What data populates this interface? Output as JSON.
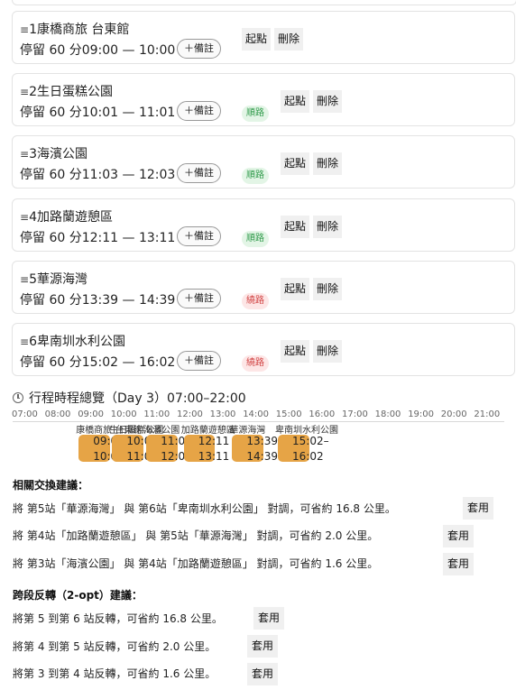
{
  "stops": [
    {
      "index": "1",
      "name": "康橋商旅 台東館",
      "stay": "停留 60 分",
      "time": "09:00 — 10:00",
      "memo": "＋備註",
      "route_badge": "",
      "start_label": "起點",
      "delete_label": "刪除"
    },
    {
      "index": "2",
      "name": "生日蛋糕公園",
      "stay": "停留 60 分",
      "time": "10:01 — 11:01",
      "memo": "＋備註",
      "route_badge": "順路",
      "route_status": "good",
      "start_label": "起點",
      "delete_label": "刪除"
    },
    {
      "index": "3",
      "name": "海濱公園",
      "stay": "停留 60 分",
      "time": "11:03 — 12:03",
      "memo": "＋備註",
      "route_badge": "順路",
      "route_status": "good",
      "start_label": "起點",
      "delete_label": "刪除"
    },
    {
      "index": "4",
      "name": "加路蘭遊憩區",
      "stay": "停留 60 分",
      "time": "12:11 — 13:11",
      "memo": "＋備註",
      "route_badge": "順路",
      "route_status": "good",
      "start_label": "起點",
      "delete_label": "刪除"
    },
    {
      "index": "5",
      "name": "華源海灣",
      "stay": "停留 60 分",
      "time": "13:39 — 14:39",
      "memo": "＋備註",
      "route_badge": "繞路",
      "route_status": "bad",
      "start_label": "起點",
      "delete_label": "刪除"
    },
    {
      "index": "6",
      "name": "卑南圳水利公園",
      "stay": "停留 60 分",
      "time": "15:02 — 16:02",
      "memo": "＋備註",
      "route_badge": "繞路",
      "route_status": "bad",
      "start_label": "起點",
      "delete_label": "刪除"
    }
  ],
  "drag_handle": "≡",
  "timeline": {
    "title": "行程時程總覽（Day 3）07:00–22:00",
    "icon": "clock-icon",
    "ticks": [
      "07:00",
      "08:00",
      "09:00",
      "10:00",
      "11:00",
      "12:00",
      "13:00",
      "14:00",
      "15:00",
      "16:00",
      "17:00",
      "18:00",
      "19:00",
      "20:00",
      "21:00"
    ],
    "bar_color": "#e6a446",
    "blocks": [
      {
        "name": "康橋商旅 台東館",
        "start": "09:00",
        "end": "10:00",
        "start_label": "09:0",
        "end_label": "10:0"
      },
      {
        "name": "生日蛋糕公園",
        "start": "10:01",
        "end": "11:01",
        "start_label": "10:0",
        "end_label": "11:0"
      },
      {
        "name": "海濱公園",
        "start": "11:03",
        "end": "12:03",
        "start_label": "11:0",
        "end_label": "12:0"
      },
      {
        "name": "加路蘭遊憩區",
        "start": "12:11",
        "end": "13:11",
        "start_label": "12:11",
        "end_label": "13:11"
      },
      {
        "name": "華源海灣",
        "start": "13:39",
        "end": "14:39",
        "start_label": "13:39",
        "end_label": "14:39"
      },
      {
        "name": "卑南圳水利公園",
        "start": "15:02",
        "end": "16:02",
        "start_label": "15:02–",
        "end_label": "16:02"
      }
    ]
  },
  "swap": {
    "title": "相關交換建議：",
    "items": [
      {
        "text": "將 第5站「華源海灣」 與 第6站「卑南圳水利公園」 對調，可省約 16.8 公里。",
        "button": "套用"
      },
      {
        "text": "將 第4站「加路蘭遊憩區」 與 第5站「華源海灣」 對調，可省約 2.0 公里。",
        "button": "套用"
      },
      {
        "text": "將 第3站「海濱公園」 與 第4站「加路蘭遊憩區」 對調，可省約 1.6 公里。",
        "button": "套用"
      }
    ]
  },
  "two_opt": {
    "title": "跨段反轉（2-opt）建議：",
    "items": [
      {
        "text": "將第 5 到第 6 站反轉，可省約 16.8 公里。",
        "button": "套用"
      },
      {
        "text": "將第 4 到第 5 站反轉，可省約 2.0 公里。",
        "button": "套用"
      },
      {
        "text": "將第 3 到第 4 站反轉，可省約 1.6 公里。",
        "button": "套用"
      }
    ]
  },
  "colors": {
    "route_good_bg": "#e3f5e6",
    "route_good_text": "#2f9a4a",
    "route_bad_bg": "#fde6e6",
    "route_bad_text": "#d14343"
  }
}
